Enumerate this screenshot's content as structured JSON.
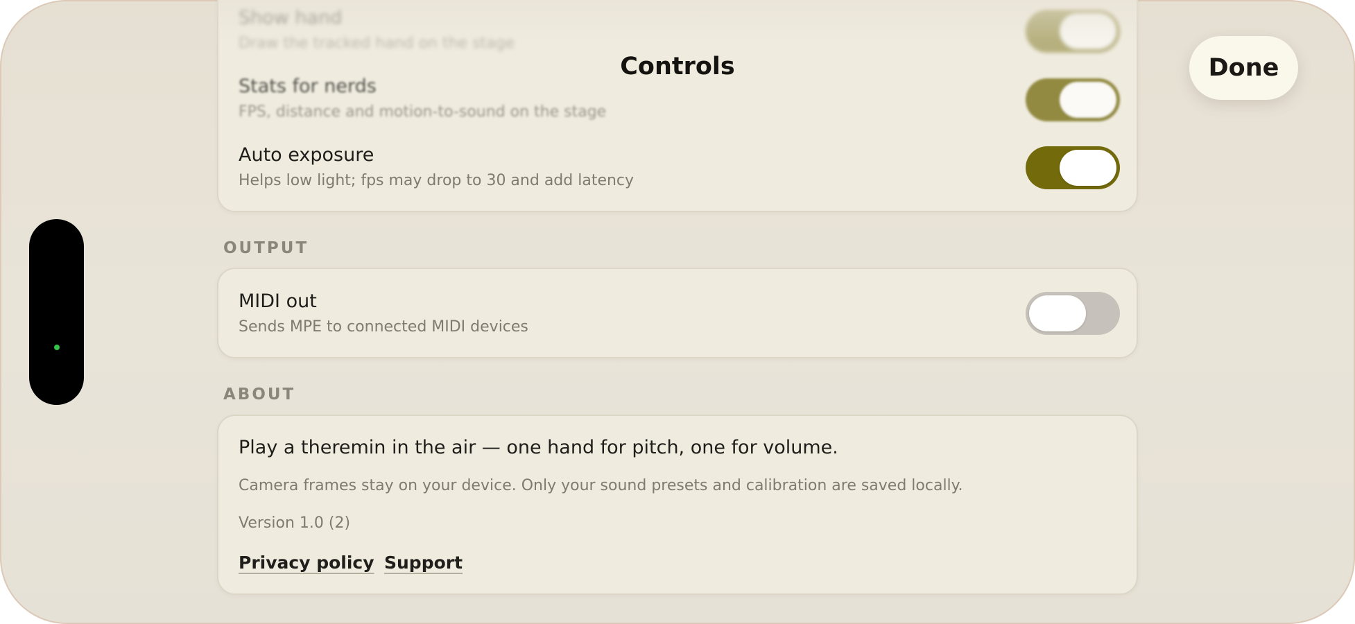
{
  "header": {
    "title": "Controls",
    "done_label": "Done"
  },
  "display_section": {
    "rows": [
      {
        "title": "Show hand",
        "subtitle": "Draw the tracked hand on the stage",
        "toggle_on": true
      },
      {
        "title": "Stats for nerds",
        "subtitle": "FPS, distance and motion-to-sound on the stage",
        "toggle_on": true
      },
      {
        "title": "Auto exposure",
        "subtitle": "Helps low light; fps may drop to 30 and add latency",
        "toggle_on": true
      }
    ]
  },
  "output_section": {
    "label": "OUTPUT",
    "rows": [
      {
        "title": "MIDI out",
        "subtitle": "Sends MPE to connected MIDI devices",
        "toggle_on": false
      }
    ]
  },
  "about_section": {
    "label": "ABOUT",
    "description": "Play a theremin in the air — one hand for pitch, one for volume.",
    "privacy_note": "Camera frames stay on your device. Only your sound presets and calibration are saved locally.",
    "version": "Version 1.0 (2)",
    "links": {
      "privacy": "Privacy policy",
      "support": "Support"
    }
  },
  "colors": {
    "accent": "#736a0c",
    "background": "#e8e3d7",
    "card": "#efebdf",
    "toggle_off": "#c6c1ba",
    "camera_indicator": "#33c24a"
  }
}
